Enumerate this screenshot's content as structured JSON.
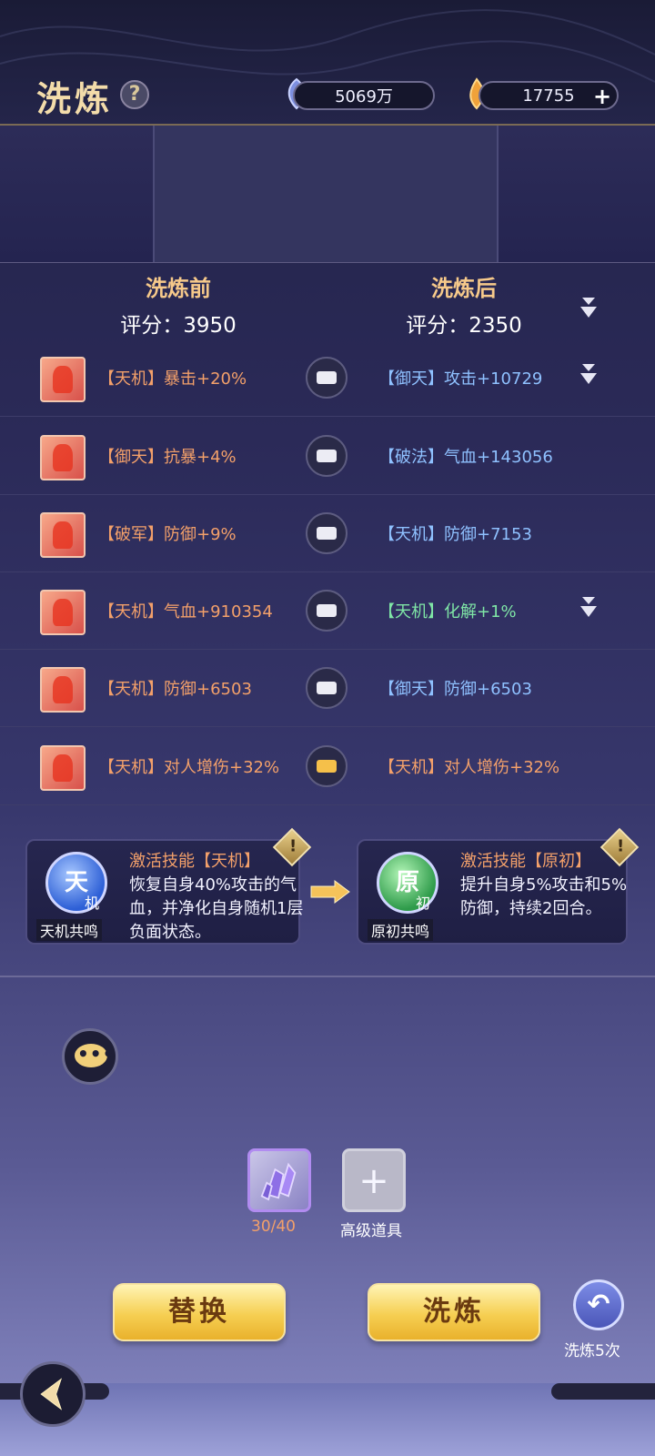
{
  "header": {
    "title": "洗炼",
    "help": "?",
    "silver": "5069万",
    "gold": "17755",
    "add": "+"
  },
  "compare": {
    "before_label": "洗炼前",
    "before_score": "评分：3950",
    "after_label": "洗炼后",
    "after_score": "评分：2350"
  },
  "rows": [
    {
      "left": "【天机】暴击+20%",
      "right": "【御天】攻击+10729",
      "down": true,
      "locked": false
    },
    {
      "left": "【御天】抗暴+4%",
      "right": "【破法】气血+143056",
      "down": false,
      "locked": false
    },
    {
      "left": "【破军】防御+9%",
      "right": "【天机】防御+7153",
      "down": false,
      "locked": false
    },
    {
      "left": "【天机】气血+910354",
      "right": "【天机】化解+1%",
      "down": true,
      "locked": false
    },
    {
      "left": "【天机】防御+6503",
      "right": "【御天】防御+6503",
      "down": false,
      "locked": false
    },
    {
      "left": "【天机】对人增伤+32%",
      "right": "【天机】对人增伤+32%",
      "down": false,
      "locked": true
    }
  ],
  "skills": {
    "before": {
      "title": "激活技能【天机】",
      "desc": "恢复自身40%攻击的气血，并净化自身随机1层负面状态。",
      "orb_main": "天",
      "orb_sub": "机",
      "label": "天机共鸣"
    },
    "after": {
      "title": "激活技能【原初】",
      "desc": "提升自身5%攻击和5%防御，持续2回合。",
      "orb_main": "原",
      "orb_sub": "初",
      "label": "原初共鸣"
    },
    "warn": "!"
  },
  "items": {
    "crystal_count": "30/40",
    "advanced_label": "高级道具",
    "add": "+"
  },
  "actions": {
    "replace": "替换",
    "refine": "洗炼",
    "undo_label": "洗炼5次"
  },
  "colors": {
    "left_text": "#f3a06a",
    "right_blue": "#8fc1ff",
    "right_green": "#7fe6a6"
  }
}
